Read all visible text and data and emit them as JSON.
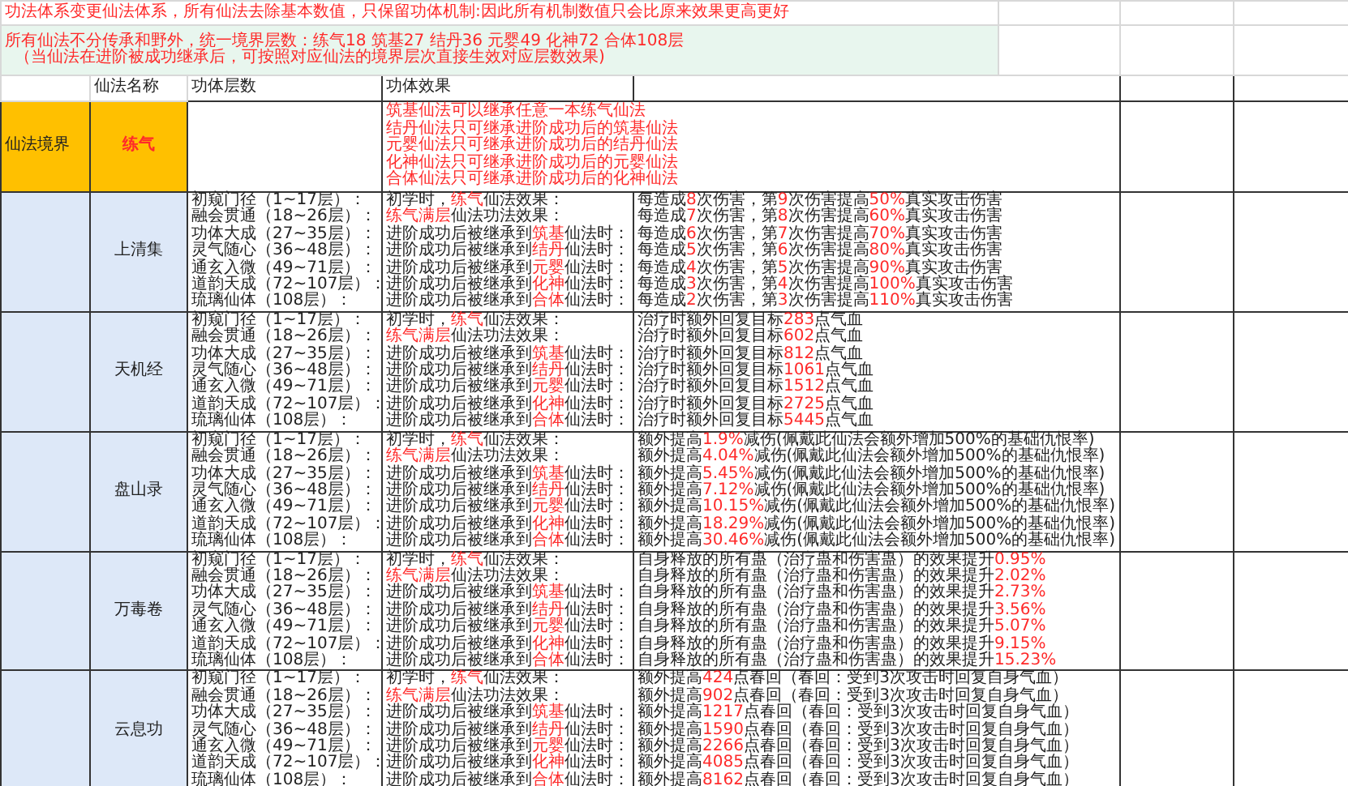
{
  "notice": "功法体系变更仙法体系，所有仙法去除基本数值，只保留功体机制:因此所有机制数值只会比原来效果更高更好",
  "banner": [
    "所有仙法不分传承和野外，统一境界层数：练气18 筑基27 结丹36 元婴49 化神72 合体108层",
    "（当仙法在进阶被成功继承后，可按照对应仙法的境界层次直接生效对应层数效果)"
  ],
  "headers": [
    "仙法名称",
    "功体层数",
    "功体效果"
  ],
  "realm": {
    "label": "仙法境界",
    "name": "练气",
    "rules": [
      "筑基仙法可以继承任意一本练气仙法",
      "结丹仙法只可继承进阶成功后的筑基仙法",
      "元婴仙法只可继承进阶成功后的结丹仙法",
      "化神仙法只可继承进阶成功后的元婴仙法",
      "合体仙法只可继承进阶成功后的化神仙法"
    ]
  },
  "skills": [
    {
      "name": "上清集",
      "rows": [
        {
          "tier": "初窥门径（1~17层）：",
          "source": [
            {
              "text": "初学时，",
              "highlight": false
            },
            {
              "text": "练气",
              "highlight": true
            },
            {
              "text": "仙法效果：",
              "highlight": false
            }
          ],
          "effect": [
            {
              "text": "每造成",
              "highlight": false
            },
            {
              "text": "8",
              "highlight": true
            },
            {
              "text": "次伤害，第",
              "highlight": false
            },
            {
              "text": "9",
              "highlight": true
            },
            {
              "text": "次伤害提高",
              "highlight": false
            },
            {
              "text": "50%",
              "highlight": true
            },
            {
              "text": "真实攻击伤害",
              "highlight": false
            }
          ]
        },
        {
          "tier": "融会贯通（18~26层）：",
          "source": [
            {
              "text": "练气满层",
              "highlight": true
            },
            {
              "text": "仙法功法效果：",
              "highlight": false
            }
          ],
          "effect": [
            {
              "text": "每造成",
              "highlight": false
            },
            {
              "text": "7",
              "highlight": true
            },
            {
              "text": "次伤害，第",
              "highlight": false
            },
            {
              "text": "8",
              "highlight": true
            },
            {
              "text": "次伤害提高",
              "highlight": false
            },
            {
              "text": "60%",
              "highlight": true
            },
            {
              "text": "真实攻击伤害",
              "highlight": false
            }
          ]
        },
        {
          "tier": "功体大成（27~35层）：",
          "source": [
            {
              "text": "进阶成功后被继承到",
              "highlight": false
            },
            {
              "text": "筑基",
              "highlight": true
            },
            {
              "text": "仙法时：",
              "highlight": false
            }
          ],
          "effect": [
            {
              "text": "每造成",
              "highlight": false
            },
            {
              "text": "6",
              "highlight": true
            },
            {
              "text": "次伤害，第",
              "highlight": false
            },
            {
              "text": "7",
              "highlight": true
            },
            {
              "text": "次伤害提高",
              "highlight": false
            },
            {
              "text": "70%",
              "highlight": true
            },
            {
              "text": "真实攻击伤害",
              "highlight": false
            }
          ]
        },
        {
          "tier": "灵气随心（36~48层）：",
          "source": [
            {
              "text": "进阶成功后被继承到",
              "highlight": false
            },
            {
              "text": "结丹",
              "highlight": true
            },
            {
              "text": "仙法时：",
              "highlight": false
            }
          ],
          "effect": [
            {
              "text": "每造成",
              "highlight": false
            },
            {
              "text": "5",
              "highlight": true
            },
            {
              "text": "次伤害，第",
              "highlight": false
            },
            {
              "text": "6",
              "highlight": true
            },
            {
              "text": "次伤害提高",
              "highlight": false
            },
            {
              "text": "80%",
              "highlight": true
            },
            {
              "text": "真实攻击伤害",
              "highlight": false
            }
          ]
        },
        {
          "tier": "通玄入微（49~71层）：",
          "source": [
            {
              "text": "进阶成功后被继承到",
              "highlight": false
            },
            {
              "text": "元婴",
              "highlight": true
            },
            {
              "text": "仙法时：",
              "highlight": false
            }
          ],
          "effect": [
            {
              "text": "每造成",
              "highlight": false
            },
            {
              "text": "4",
              "highlight": true
            },
            {
              "text": "次伤害，第",
              "highlight": false
            },
            {
              "text": "5",
              "highlight": true
            },
            {
              "text": "次伤害提高",
              "highlight": false
            },
            {
              "text": "90%",
              "highlight": true
            },
            {
              "text": "真实攻击伤害",
              "highlight": false
            }
          ]
        },
        {
          "tier": "道韵天成（72~107层）：",
          "source": [
            {
              "text": "进阶成功后被继承到",
              "highlight": false
            },
            {
              "text": "化神",
              "highlight": true
            },
            {
              "text": "仙法时：",
              "highlight": false
            }
          ],
          "effect": [
            {
              "text": "每造成",
              "highlight": false
            },
            {
              "text": "3",
              "highlight": true
            },
            {
              "text": "次伤害，第",
              "highlight": false
            },
            {
              "text": "4",
              "highlight": true
            },
            {
              "text": "次伤害提高",
              "highlight": false
            },
            {
              "text": "100%",
              "highlight": true
            },
            {
              "text": "真实攻击伤害",
              "highlight": false
            }
          ]
        },
        {
          "tier": "琉璃仙体（108层）：",
          "source": [
            {
              "text": "进阶成功后被继承到",
              "highlight": false
            },
            {
              "text": "合体",
              "highlight": true
            },
            {
              "text": "仙法时：",
              "highlight": false
            }
          ],
          "effect": [
            {
              "text": "每造成",
              "highlight": false
            },
            {
              "text": "2",
              "highlight": true
            },
            {
              "text": "次伤害，第",
              "highlight": false
            },
            {
              "text": "3",
              "highlight": true
            },
            {
              "text": "次伤害提高",
              "highlight": false
            },
            {
              "text": "110%",
              "highlight": true
            },
            {
              "text": "真实攻击伤害",
              "highlight": false
            }
          ]
        }
      ]
    },
    {
      "name": "天机经",
      "rows": [
        {
          "tier": "初窥门径（1~17层）：",
          "source": [
            {
              "text": "初学时，",
              "highlight": false
            },
            {
              "text": "练气",
              "highlight": true
            },
            {
              "text": "仙法效果：",
              "highlight": false
            }
          ],
          "effect": [
            {
              "text": "治疗时额外回复目标",
              "highlight": false
            },
            {
              "text": "283",
              "highlight": true
            },
            {
              "text": "点气血",
              "highlight": false
            }
          ]
        },
        {
          "tier": "融会贯通（18~26层）：",
          "source": [
            {
              "text": "练气满层",
              "highlight": true
            },
            {
              "text": "仙法功法效果：",
              "highlight": false
            }
          ],
          "effect": [
            {
              "text": "治疗时额外回复目标",
              "highlight": false
            },
            {
              "text": "602",
              "highlight": true
            },
            {
              "text": "点气血",
              "highlight": false
            }
          ]
        },
        {
          "tier": "功体大成（27~35层）：",
          "source": [
            {
              "text": "进阶成功后被继承到",
              "highlight": false
            },
            {
              "text": "筑基",
              "highlight": true
            },
            {
              "text": "仙法时：",
              "highlight": false
            }
          ],
          "effect": [
            {
              "text": "治疗时额外回复目标",
              "highlight": false
            },
            {
              "text": "812",
              "highlight": true
            },
            {
              "text": "点气血",
              "highlight": false
            }
          ]
        },
        {
          "tier": "灵气随心（36~48层）：",
          "source": [
            {
              "text": "进阶成功后被继承到",
              "highlight": false
            },
            {
              "text": "结丹",
              "highlight": true
            },
            {
              "text": "仙法时：",
              "highlight": false
            }
          ],
          "effect": [
            {
              "text": "治疗时额外回复目标",
              "highlight": false
            },
            {
              "text": "1061",
              "highlight": true
            },
            {
              "text": "点气血",
              "highlight": false
            }
          ]
        },
        {
          "tier": "通玄入微（49~71层）：",
          "source": [
            {
              "text": "进阶成功后被继承到",
              "highlight": false
            },
            {
              "text": "元婴",
              "highlight": true
            },
            {
              "text": "仙法时：",
              "highlight": false
            }
          ],
          "effect": [
            {
              "text": "治疗时额外回复目标",
              "highlight": false
            },
            {
              "text": "1512",
              "highlight": true
            },
            {
              "text": "点气血",
              "highlight": false
            }
          ]
        },
        {
          "tier": "道韵天成（72~107层）：",
          "source": [
            {
              "text": "进阶成功后被继承到",
              "highlight": false
            },
            {
              "text": "化神",
              "highlight": true
            },
            {
              "text": "仙法时：",
              "highlight": false
            }
          ],
          "effect": [
            {
              "text": "治疗时额外回复目标",
              "highlight": false
            },
            {
              "text": "2725",
              "highlight": true
            },
            {
              "text": "点气血",
              "highlight": false
            }
          ]
        },
        {
          "tier": "琉璃仙体（108层）：",
          "source": [
            {
              "text": "进阶成功后被继承到",
              "highlight": false
            },
            {
              "text": "合体",
              "highlight": true
            },
            {
              "text": "仙法时：",
              "highlight": false
            }
          ],
          "effect": [
            {
              "text": "治疗时额外回复目标",
              "highlight": false
            },
            {
              "text": "5445",
              "highlight": true
            },
            {
              "text": "点气血",
              "highlight": false
            }
          ]
        }
      ]
    },
    {
      "name": "盘山录",
      "rows": [
        {
          "tier": "初窥门径（1~17层）：",
          "source": [
            {
              "text": "初学时，",
              "highlight": false
            },
            {
              "text": "练气",
              "highlight": true
            },
            {
              "text": "仙法效果：",
              "highlight": false
            }
          ],
          "effect": [
            {
              "text": "额外提高",
              "highlight": false
            },
            {
              "text": "1.9%",
              "highlight": true
            },
            {
              "text": "减伤(佩戴此仙法会额外增加500%的基础仇恨率)",
              "highlight": false
            }
          ]
        },
        {
          "tier": "融会贯通（18~26层）：",
          "source": [
            {
              "text": "练气满层",
              "highlight": true
            },
            {
              "text": "仙法功法效果：",
              "highlight": false
            }
          ],
          "effect": [
            {
              "text": "额外提高",
              "highlight": false
            },
            {
              "text": "4.04%",
              "highlight": true
            },
            {
              "text": "减伤(佩戴此仙法会额外增加500%的基础仇恨率)",
              "highlight": false
            }
          ]
        },
        {
          "tier": "功体大成（27~35层）：",
          "source": [
            {
              "text": "进阶成功后被继承到",
              "highlight": false
            },
            {
              "text": "筑基",
              "highlight": true
            },
            {
              "text": "仙法时：",
              "highlight": false
            }
          ],
          "effect": [
            {
              "text": "额外提高",
              "highlight": false
            },
            {
              "text": "5.45%",
              "highlight": true
            },
            {
              "text": "减伤(佩戴此仙法会额外增加500%的基础仇恨率)",
              "highlight": false
            }
          ]
        },
        {
          "tier": "灵气随心（36~48层）：",
          "source": [
            {
              "text": "进阶成功后被继承到",
              "highlight": false
            },
            {
              "text": "结丹",
              "highlight": true
            },
            {
              "text": "仙法时：",
              "highlight": false
            }
          ],
          "effect": [
            {
              "text": "额外提高",
              "highlight": false
            },
            {
              "text": "7.12%",
              "highlight": true
            },
            {
              "text": "减伤(佩戴此仙法会额外增加500%的基础仇恨率)",
              "highlight": false
            }
          ]
        },
        {
          "tier": "通玄入微（49~71层）：",
          "source": [
            {
              "text": "进阶成功后被继承到",
              "highlight": false
            },
            {
              "text": "元婴",
              "highlight": true
            },
            {
              "text": "仙法时：",
              "highlight": false
            }
          ],
          "effect": [
            {
              "text": "额外提高",
              "highlight": false
            },
            {
              "text": "10.15%",
              "highlight": true
            },
            {
              "text": "减伤(佩戴此仙法会额外增加500%的基础仇恨率)",
              "highlight": false
            }
          ]
        },
        {
          "tier": "道韵天成（72~107层）：",
          "source": [
            {
              "text": "进阶成功后被继承到",
              "highlight": false
            },
            {
              "text": "化神",
              "highlight": true
            },
            {
              "text": "仙法时：",
              "highlight": false
            }
          ],
          "effect": [
            {
              "text": "额外提高",
              "highlight": false
            },
            {
              "text": "18.29%",
              "highlight": true
            },
            {
              "text": "减伤(佩戴此仙法会额外增加500%的基础仇恨率)",
              "highlight": false
            }
          ]
        },
        {
          "tier": "琉璃仙体（108层）：",
          "source": [
            {
              "text": "进阶成功后被继承到",
              "highlight": false
            },
            {
              "text": "合体",
              "highlight": true
            },
            {
              "text": "仙法时：",
              "highlight": false
            }
          ],
          "effect": [
            {
              "text": "额外提高",
              "highlight": false
            },
            {
              "text": "30.46%",
              "highlight": true
            },
            {
              "text": "减伤(佩戴此仙法会额外增加500%的基础仇恨率)",
              "highlight": false
            }
          ]
        }
      ]
    },
    {
      "name": "万毒卷",
      "rows": [
        {
          "tier": "初窥门径（1~17层）：",
          "source": [
            {
              "text": "初学时，",
              "highlight": false
            },
            {
              "text": "练气",
              "highlight": true
            },
            {
              "text": "仙法效果：",
              "highlight": false
            }
          ],
          "effect": [
            {
              "text": "自身释放的所有蛊（治疗蛊和伤害蛊）的效果提升",
              "highlight": false
            },
            {
              "text": "0.95%",
              "highlight": true
            }
          ]
        },
        {
          "tier": "融会贯通（18~26层）：",
          "source": [
            {
              "text": "练气满层",
              "highlight": true
            },
            {
              "text": "仙法功法效果：",
              "highlight": false
            }
          ],
          "effect": [
            {
              "text": "自身释放的所有蛊（治疗蛊和伤害蛊）的效果提升",
              "highlight": false
            },
            {
              "text": "2.02%",
              "highlight": true
            }
          ]
        },
        {
          "tier": "功体大成（27~35层）：",
          "source": [
            {
              "text": "进阶成功后被继承到",
              "highlight": false
            },
            {
              "text": "筑基",
              "highlight": true
            },
            {
              "text": "仙法时：",
              "highlight": false
            }
          ],
          "effect": [
            {
              "text": "自身释放的所有蛊（治疗蛊和伤害蛊）的效果提升",
              "highlight": false
            },
            {
              "text": "2.73%",
              "highlight": true
            }
          ]
        },
        {
          "tier": "灵气随心（36~48层）：",
          "source": [
            {
              "text": "进阶成功后被继承到",
              "highlight": false
            },
            {
              "text": "结丹",
              "highlight": true
            },
            {
              "text": "仙法时：",
              "highlight": false
            }
          ],
          "effect": [
            {
              "text": "自身释放的所有蛊（治疗蛊和伤害蛊）的效果提升",
              "highlight": false
            },
            {
              "text": "3.56%",
              "highlight": true
            }
          ]
        },
        {
          "tier": "通玄入微（49~71层）：",
          "source": [
            {
              "text": "进阶成功后被继承到",
              "highlight": false
            },
            {
              "text": "元婴",
              "highlight": true
            },
            {
              "text": "仙法时：",
              "highlight": false
            }
          ],
          "effect": [
            {
              "text": "自身释放的所有蛊（治疗蛊和伤害蛊）的效果提升",
              "highlight": false
            },
            {
              "text": "5.07%",
              "highlight": true
            }
          ]
        },
        {
          "tier": "道韵天成（72~107层）：",
          "source": [
            {
              "text": "进阶成功后被继承到",
              "highlight": false
            },
            {
              "text": "化神",
              "highlight": true
            },
            {
              "text": "仙法时：",
              "highlight": false
            }
          ],
          "effect": [
            {
              "text": "自身释放的所有蛊（治疗蛊和伤害蛊）的效果提升",
              "highlight": false
            },
            {
              "text": "9.15%",
              "highlight": true
            }
          ]
        },
        {
          "tier": "琉璃仙体（108层）：",
          "source": [
            {
              "text": "进阶成功后被继承到",
              "highlight": false
            },
            {
              "text": "合体",
              "highlight": true
            },
            {
              "text": "仙法时：",
              "highlight": false
            }
          ],
          "effect": [
            {
              "text": "自身释放的所有蛊（治疗蛊和伤害蛊）的效果提升",
              "highlight": false
            },
            {
              "text": "15.23%",
              "highlight": true
            }
          ]
        }
      ]
    },
    {
      "name": "云息功",
      "rows": [
        {
          "tier": "初窥门径（1~17层）：",
          "source": [
            {
              "text": "初学时，",
              "highlight": false
            },
            {
              "text": "练气",
              "highlight": true
            },
            {
              "text": "仙法效果：",
              "highlight": false
            }
          ],
          "effect": [
            {
              "text": "额外提高",
              "highlight": false
            },
            {
              "text": "424",
              "highlight": true
            },
            {
              "text": "点春回（春回：受到3次攻击时回复自身气血）",
              "highlight": false
            }
          ]
        },
        {
          "tier": "融会贯通（18~26层）：",
          "source": [
            {
              "text": "练气满层",
              "highlight": true
            },
            {
              "text": "仙法功法效果：",
              "highlight": false
            }
          ],
          "effect": [
            {
              "text": "额外提高",
              "highlight": false
            },
            {
              "text": "902",
              "highlight": true
            },
            {
              "text": "点春回（春回：受到3次攻击时回复自身气血）",
              "highlight": false
            }
          ]
        },
        {
          "tier": "功体大成（27~35层）：",
          "source": [
            {
              "text": "进阶成功后被继承到",
              "highlight": false
            },
            {
              "text": "筑基",
              "highlight": true
            },
            {
              "text": "仙法时：",
              "highlight": false
            }
          ],
          "effect": [
            {
              "text": "额外提高",
              "highlight": false
            },
            {
              "text": "1217",
              "highlight": true
            },
            {
              "text": "点春回（春回：受到3次攻击时回复自身气血）",
              "highlight": false
            }
          ]
        },
        {
          "tier": "灵气随心（36~48层）：",
          "source": [
            {
              "text": "进阶成功后被继承到",
              "highlight": false
            },
            {
              "text": "结丹",
              "highlight": true
            },
            {
              "text": "仙法时：",
              "highlight": false
            }
          ],
          "effect": [
            {
              "text": "额外提高",
              "highlight": false
            },
            {
              "text": "1590",
              "highlight": true
            },
            {
              "text": "点春回（春回：受到3次攻击时回复自身气血）",
              "highlight": false
            }
          ]
        },
        {
          "tier": "通玄入微（49~71层）：",
          "source": [
            {
              "text": "进阶成功后被继承到",
              "highlight": false
            },
            {
              "text": "元婴",
              "highlight": true
            },
            {
              "text": "仙法时：",
              "highlight": false
            }
          ],
          "effect": [
            {
              "text": "额外提高",
              "highlight": false
            },
            {
              "text": "2266",
              "highlight": true
            },
            {
              "text": "点春回（春回：受到3次攻击时回复自身气血）",
              "highlight": false
            }
          ]
        },
        {
          "tier": "道韵天成（72~107层）：",
          "source": [
            {
              "text": "进阶成功后被继承到",
              "highlight": false
            },
            {
              "text": "化神",
              "highlight": true
            },
            {
              "text": "仙法时：",
              "highlight": false
            }
          ],
          "effect": [
            {
              "text": "额外提高",
              "highlight": false
            },
            {
              "text": "4085",
              "highlight": true
            },
            {
              "text": "点春回（春回：受到3次攻击时回复自身气血）",
              "highlight": false
            }
          ]
        },
        {
          "tier": "琉璃仙体（108层）：",
          "source": [
            {
              "text": "进阶成功后被继承到",
              "highlight": false
            },
            {
              "text": "合体",
              "highlight": true
            },
            {
              "text": "仙法时：",
              "highlight": false
            }
          ],
          "effect": [
            {
              "text": "额外提高",
              "highlight": false
            },
            {
              "text": "8162",
              "highlight": true
            },
            {
              "text": "点春回（春回：受到3次攻击时回复自身气血）",
              "highlight": false
            }
          ]
        }
      ]
    }
  ]
}
